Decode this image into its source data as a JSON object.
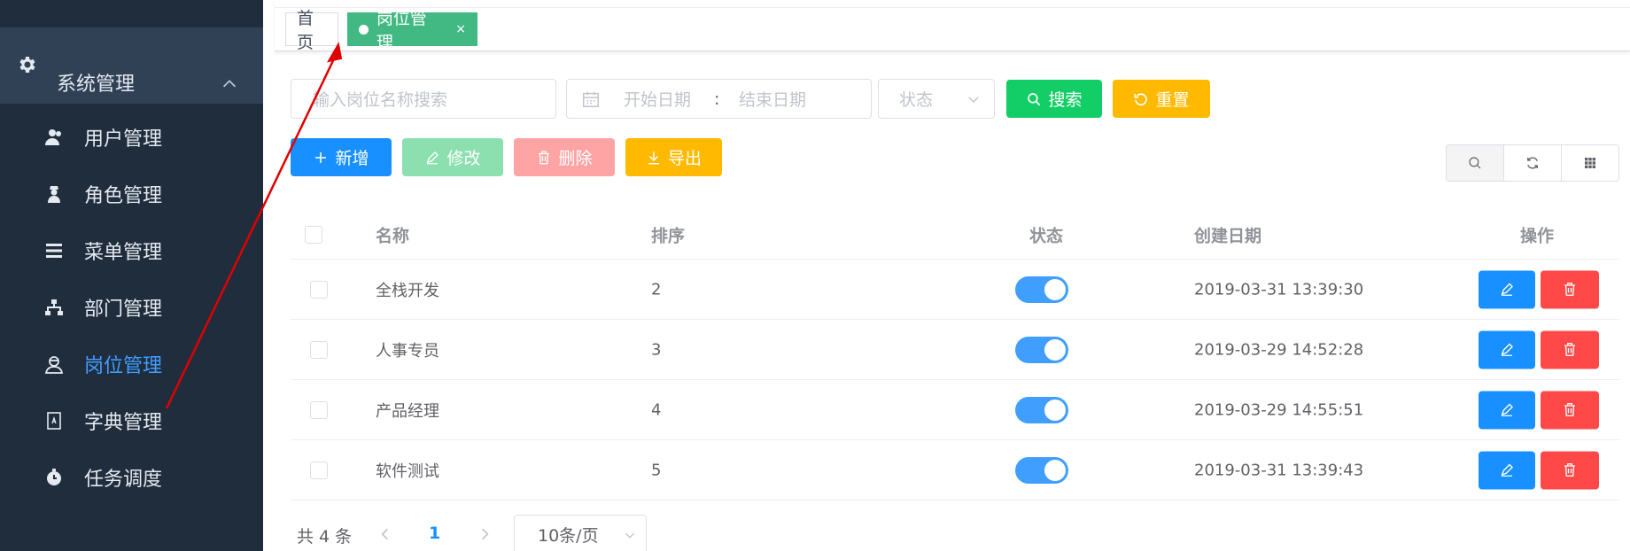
{
  "sidebar": {
    "parent": {
      "label": "系统管理",
      "icon": "gear-icon"
    },
    "items": [
      {
        "label": "用户管理",
        "icon": "user-icon",
        "active": false
      },
      {
        "label": "角色管理",
        "icon": "role-icon",
        "active": false
      },
      {
        "label": "菜单管理",
        "icon": "menu-list-icon",
        "active": false
      },
      {
        "label": "部门管理",
        "icon": "org-tree-icon",
        "active": false
      },
      {
        "label": "岗位管理",
        "icon": "post-icon",
        "active": true
      },
      {
        "label": "字典管理",
        "icon": "dictionary-icon",
        "active": false
      },
      {
        "label": "任务调度",
        "icon": "timer-icon",
        "active": false
      }
    ]
  },
  "tabs": {
    "home": "首页",
    "active": "岗位管理",
    "close": "×"
  },
  "filters": {
    "name_placeholder": "输入岗位名称搜索",
    "start_date": "开始日期",
    "separator": ":",
    "end_date": "结束日期",
    "status_placeholder": "状态",
    "search_label": "搜索",
    "reset_label": "重置"
  },
  "toolbar": {
    "add_label": "新增",
    "edit_label": "修改",
    "delete_label": "删除",
    "export_label": "导出"
  },
  "table": {
    "columns": {
      "name": "名称",
      "sort": "排序",
      "status": "状态",
      "created": "创建日期",
      "actions": "操作"
    },
    "rows": [
      {
        "name": "全栈开发",
        "sort": "2",
        "enabled": true,
        "created": "2019-03-31 13:39:30"
      },
      {
        "name": "人事专员",
        "sort": "3",
        "enabled": true,
        "created": "2019-03-29 14:52:28"
      },
      {
        "name": "产品经理",
        "sort": "4",
        "enabled": true,
        "created": "2019-03-29 14:55:51"
      },
      {
        "name": "软件测试",
        "sort": "5",
        "enabled": true,
        "created": "2019-03-31 13:39:43"
      }
    ]
  },
  "pagination": {
    "total": "共 4 条",
    "current": "1",
    "page_size": "10条/页"
  },
  "colors": {
    "sidebar_bg": "#1f2d3d",
    "accent": "#409eff",
    "success": "#13ce66",
    "warning": "#ffba00",
    "danger": "#ff4949",
    "annotation_arrow": "#e00000"
  }
}
